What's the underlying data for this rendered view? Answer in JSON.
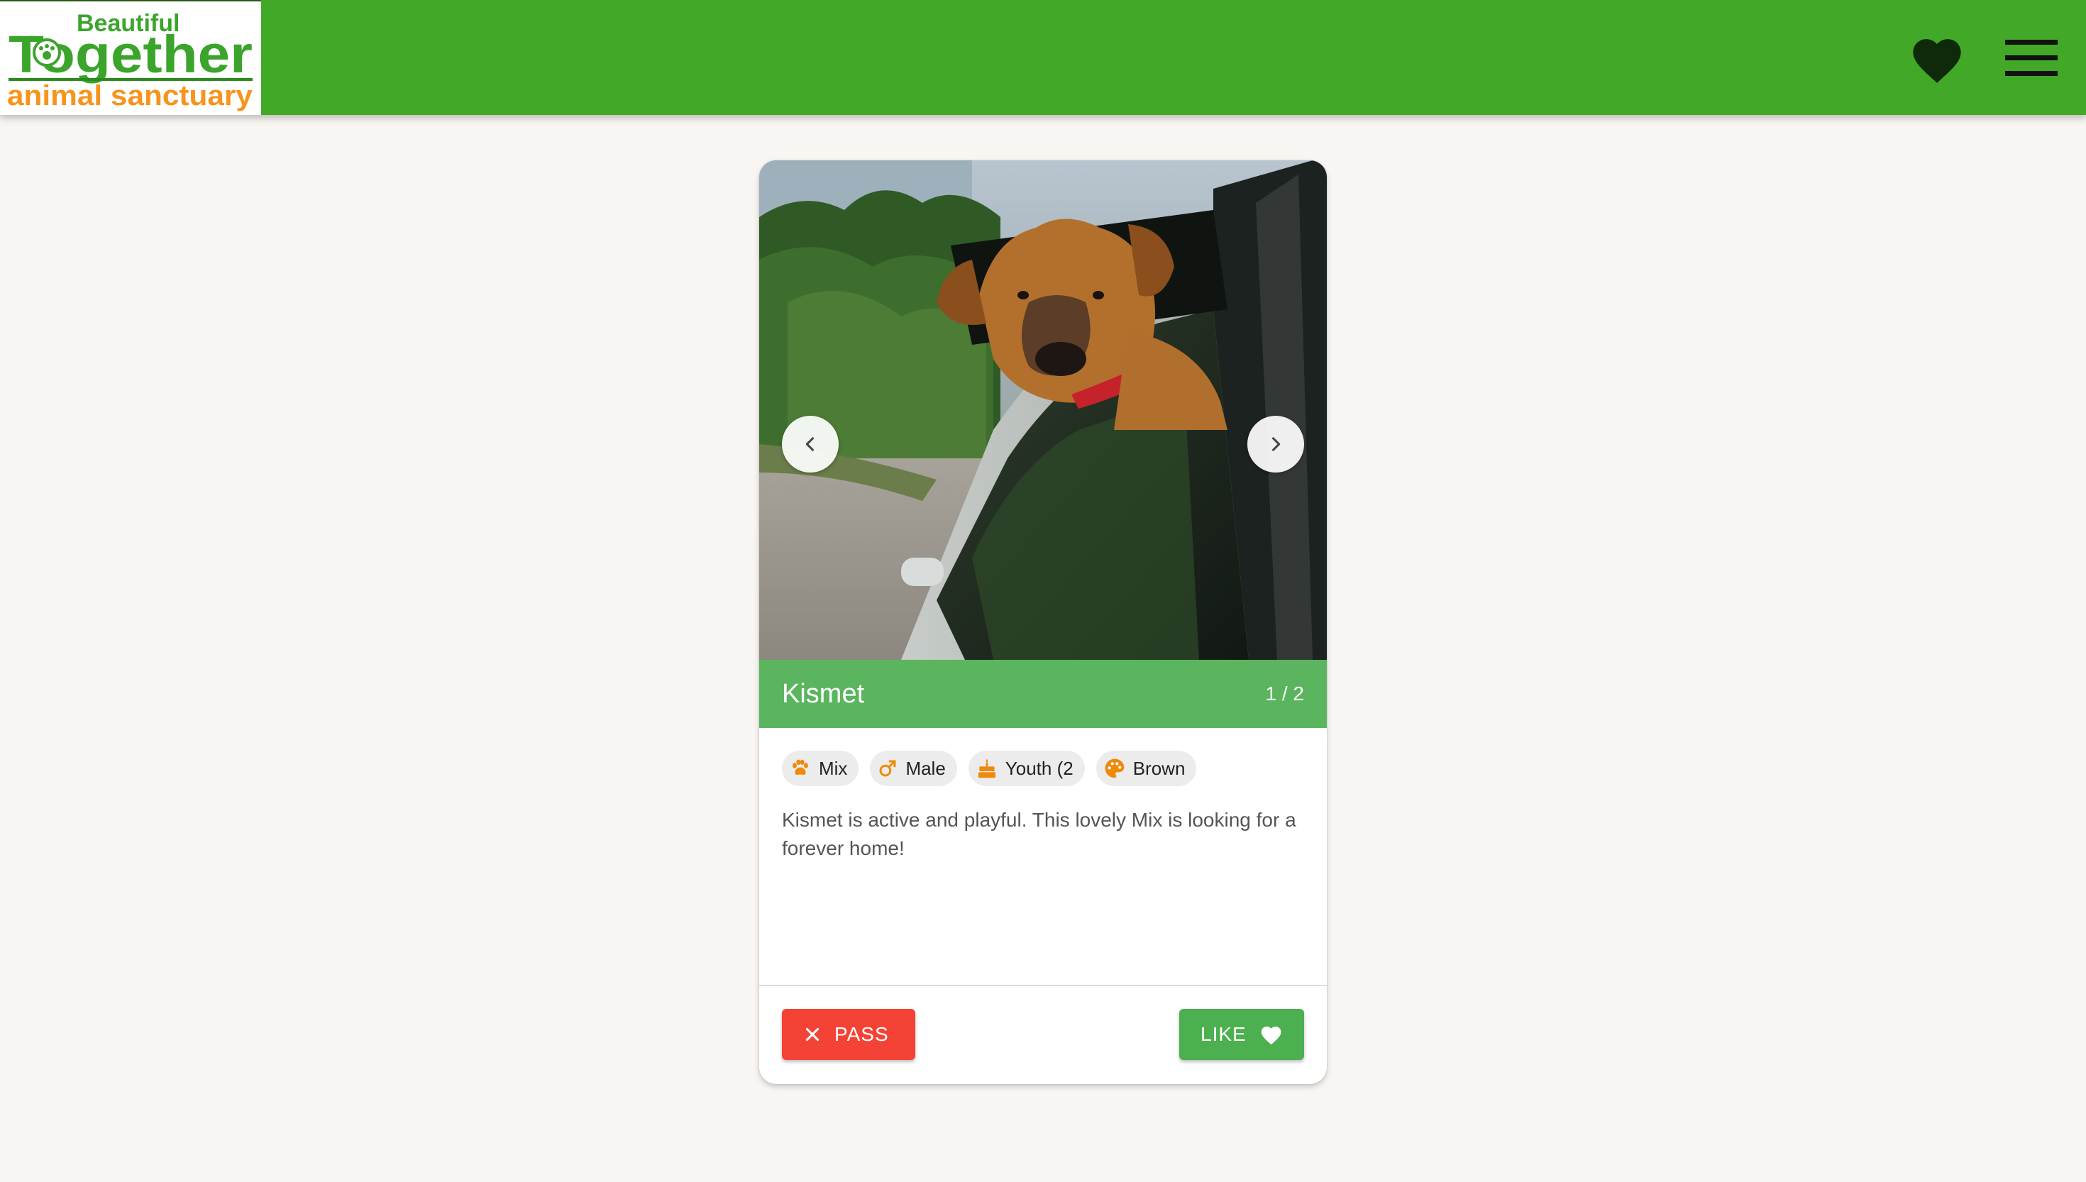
{
  "header": {
    "logo": {
      "line1": "Beautiful",
      "line2": "Together",
      "line3": "animal sanctuary"
    },
    "favorites_icon": "heart-icon",
    "menu_icon": "hamburger-menu-icon"
  },
  "card": {
    "name": "Kismet",
    "photo_counter": "1 / 2",
    "chips": [
      {
        "icon": "paw-icon",
        "label": "Mix"
      },
      {
        "icon": "male-icon",
        "label": "Male"
      },
      {
        "icon": "cake-icon",
        "label": "Youth (2"
      },
      {
        "icon": "palette-icon",
        "label": "Brown"
      }
    ],
    "description": "Kismet is active and playful. This lovely Mix is looking for a forever home!",
    "pass_label": "PASS",
    "like_label": "LIKE"
  },
  "colors": {
    "header": "#42a828",
    "name_bar": "#4caf50",
    "pass": "#f44336",
    "like": "#4caf50",
    "chip_icon": "#f0890a",
    "background": "#f8f5f2"
  }
}
